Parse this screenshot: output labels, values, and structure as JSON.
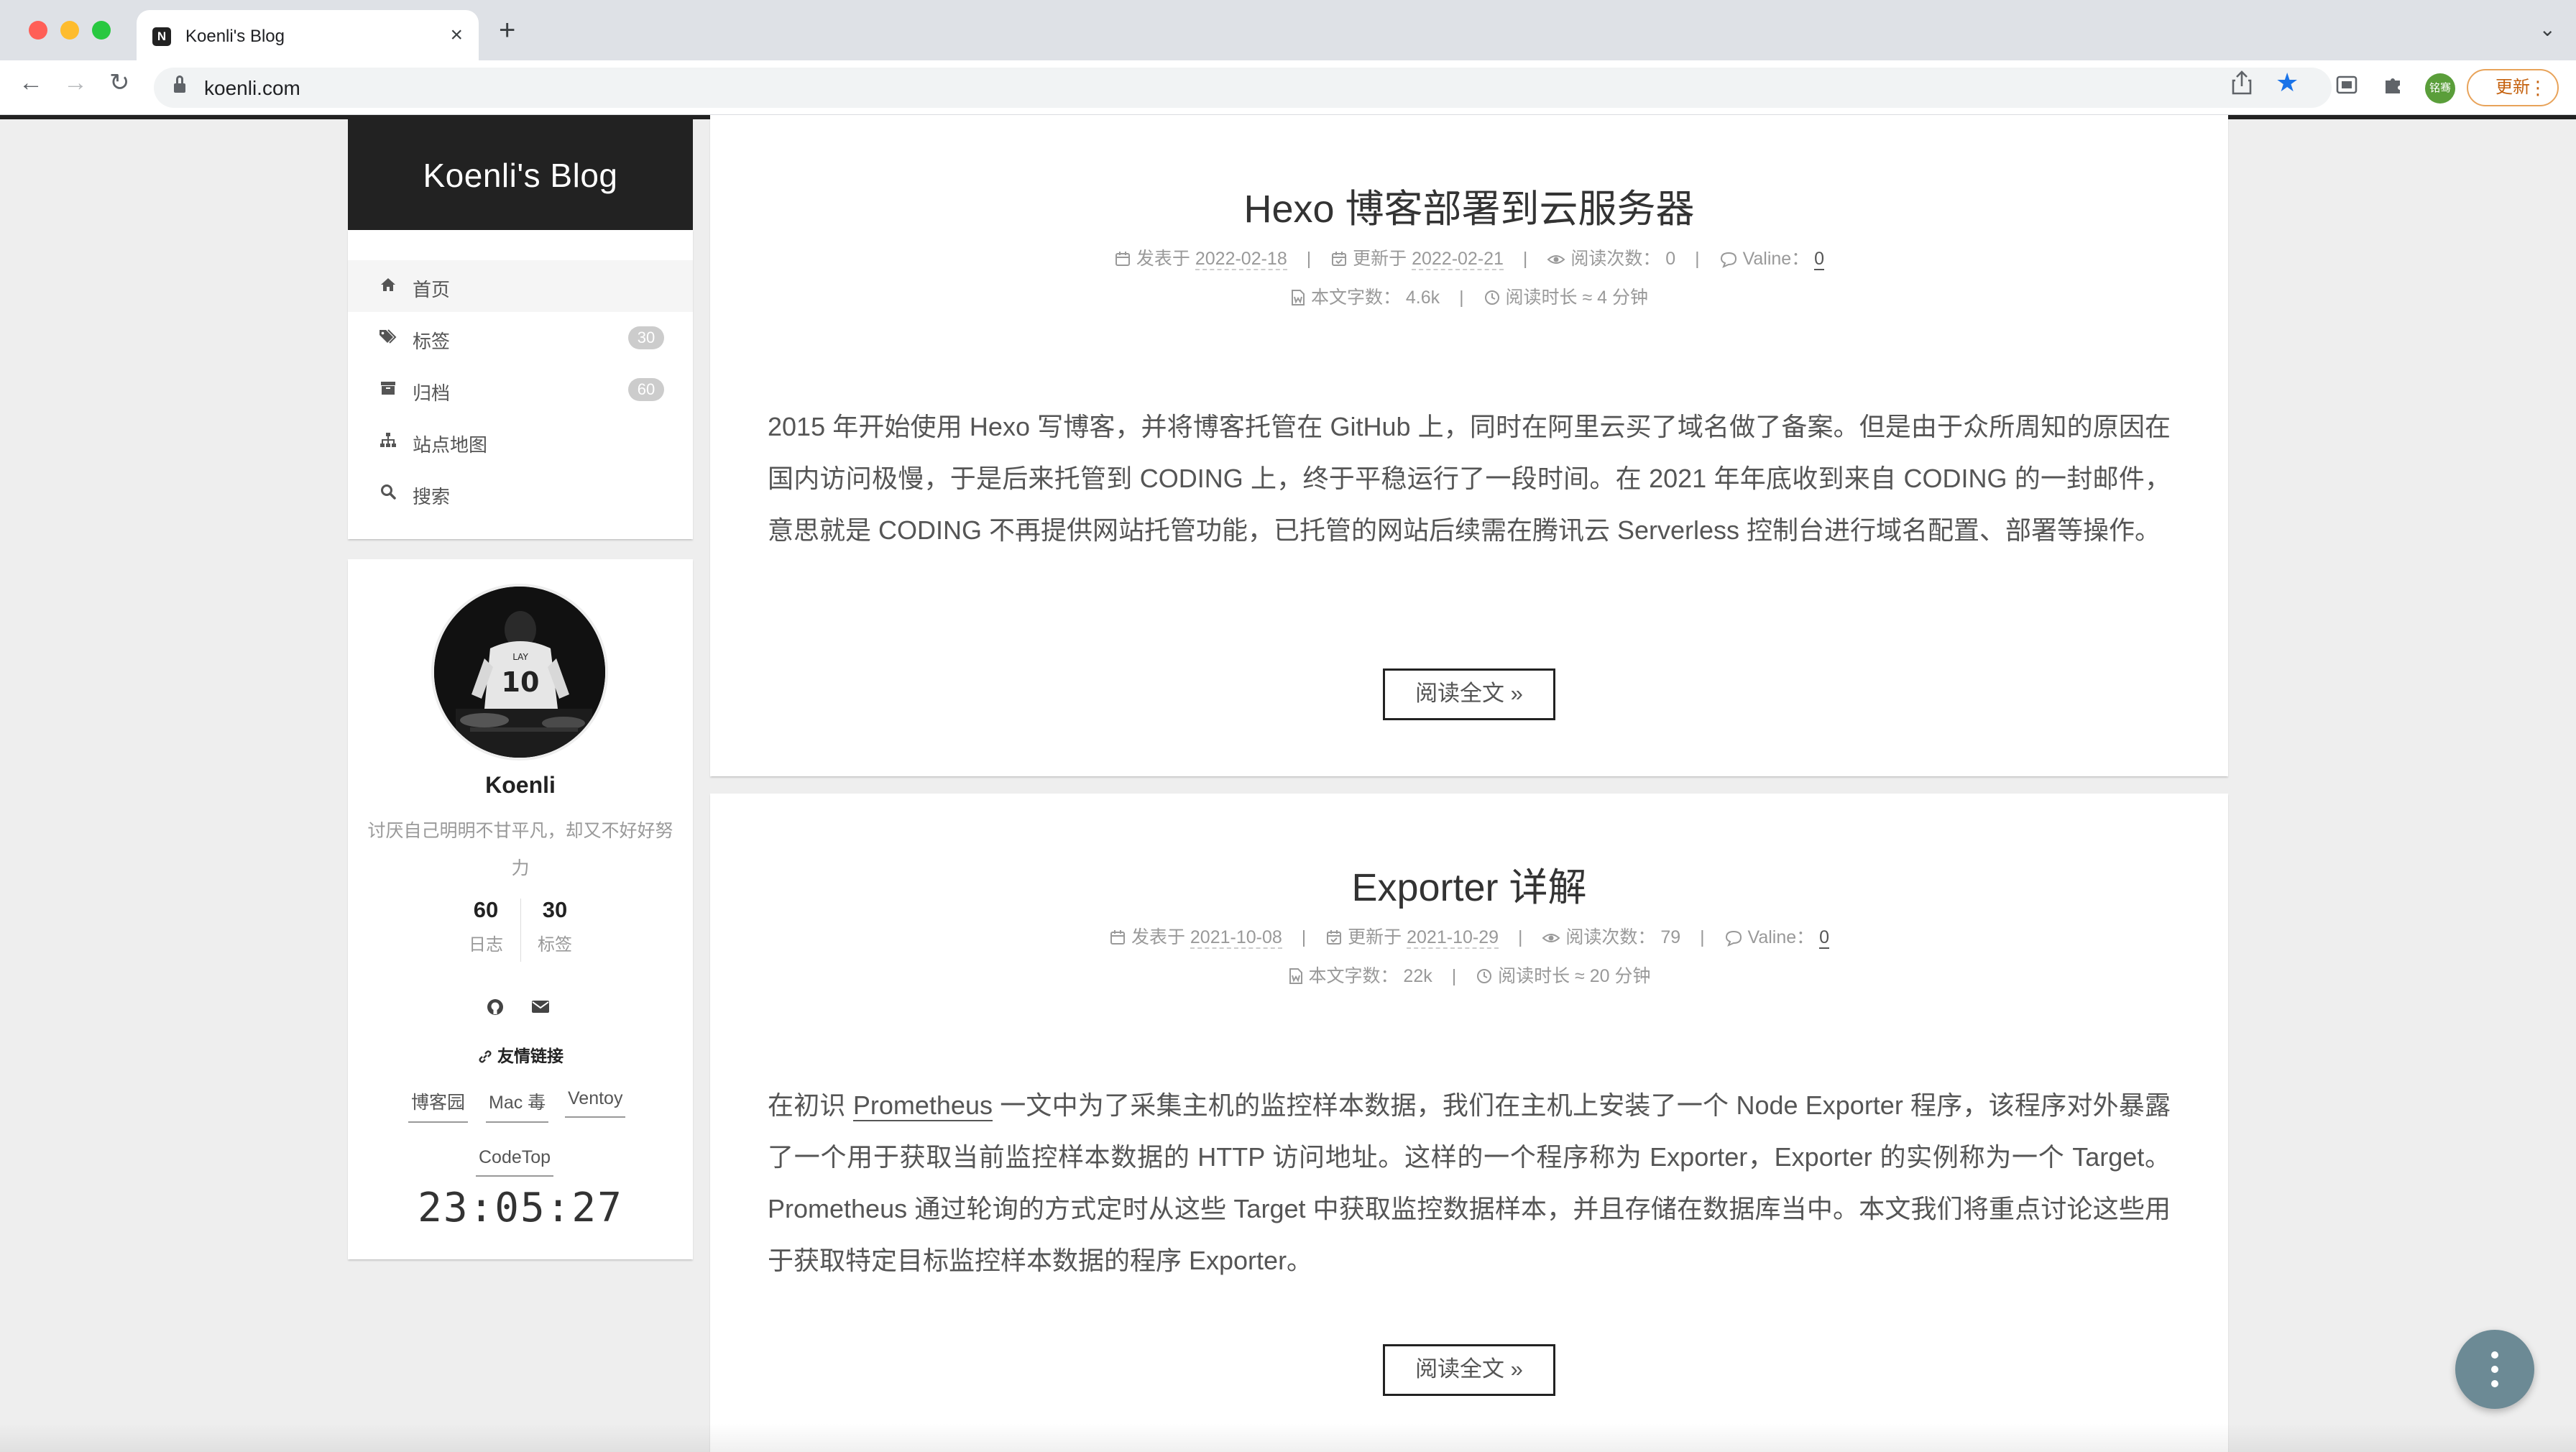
{
  "browser": {
    "tab_title": "Koenli's Blog",
    "tab_favicon_letter": "N",
    "url": "koenli.com",
    "profile_badge": "铭骞",
    "update_label": "更新"
  },
  "site": {
    "brand_title": "Koenli's Blog",
    "menu": [
      {
        "label": "首页",
        "icon": "home-icon",
        "active": true
      },
      {
        "label": "标签",
        "icon": "tags-icon",
        "badge": "30"
      },
      {
        "label": "归档",
        "icon": "archive-icon",
        "badge": "60"
      },
      {
        "label": "站点地图",
        "icon": "sitemap-icon"
      },
      {
        "label": "搜索",
        "icon": "search-icon"
      }
    ]
  },
  "profile": {
    "name": "Koenli",
    "description": "讨厌自己明明不甘平凡，却又不好好努力",
    "posts_count": "60",
    "posts_label": "日志",
    "tags_count": "30",
    "tags_label": "标签",
    "links_title": "友情链接",
    "links": [
      "博客园",
      "Mac 毒",
      "Ventoy",
      "CodeTop"
    ],
    "clock": "23:05:27"
  },
  "posts": [
    {
      "title": "Hexo 博客部署到云服务器",
      "published_label": "发表于",
      "published": "2022-02-18",
      "updated_label": "更新于",
      "updated": "2022-02-21",
      "views_label": "阅读次数：",
      "views": "0",
      "valine_label": "Valine：",
      "valine": "0",
      "words_label": "本文字数：",
      "words": "4.6k",
      "time_label": "阅读时长 ≈",
      "time": "4 分钟",
      "excerpt": "2015 年开始使用 Hexo 写博客，并将博客托管在 GitHub 上，同时在阿里云买了域名做了备案。但是由于众所周知的原因在国内访问极慢，于是后来托管到 CODING 上，终于平稳运行了一段时间。在 2021 年年底收到来自 CODING 的一封邮件，意思就是 CODING 不再提供网站托管功能，已托管的网站后续需在腾讯云 Serverless 控制台进行域名配置、部署等操作。",
      "read_more": "阅读全文 »"
    },
    {
      "title": "Exporter 详解",
      "published_label": "发表于",
      "published": "2021-10-08",
      "updated_label": "更新于",
      "updated": "2021-10-29",
      "views_label": "阅读次数：",
      "views": "79",
      "valine_label": "Valine：",
      "valine": "0",
      "words_label": "本文字数：",
      "words": "22k",
      "time_label": "阅读时长 ≈",
      "time": "20 分钟",
      "excerpt_prefix": "在初识 ",
      "excerpt_link": "Prometheus",
      "excerpt": " 一文中为了采集主机的监控样本数据，我们在主机上安装了一个 Node Exporter 程序，该程序对外暴露了一个用于获取当前监控样本数据的 HTTP 访问地址。这样的一个程序称为 Exporter，Exporter 的实例称为一个 Target。Prometheus 通过轮询的方式定时从这些 Target 中获取监控数据样本，并且存储在数据库当中。本文我们将重点讨论这些用于获取特定目标监控样本数据的程序 Exporter。",
      "read_more": "阅读全文 »"
    }
  ]
}
